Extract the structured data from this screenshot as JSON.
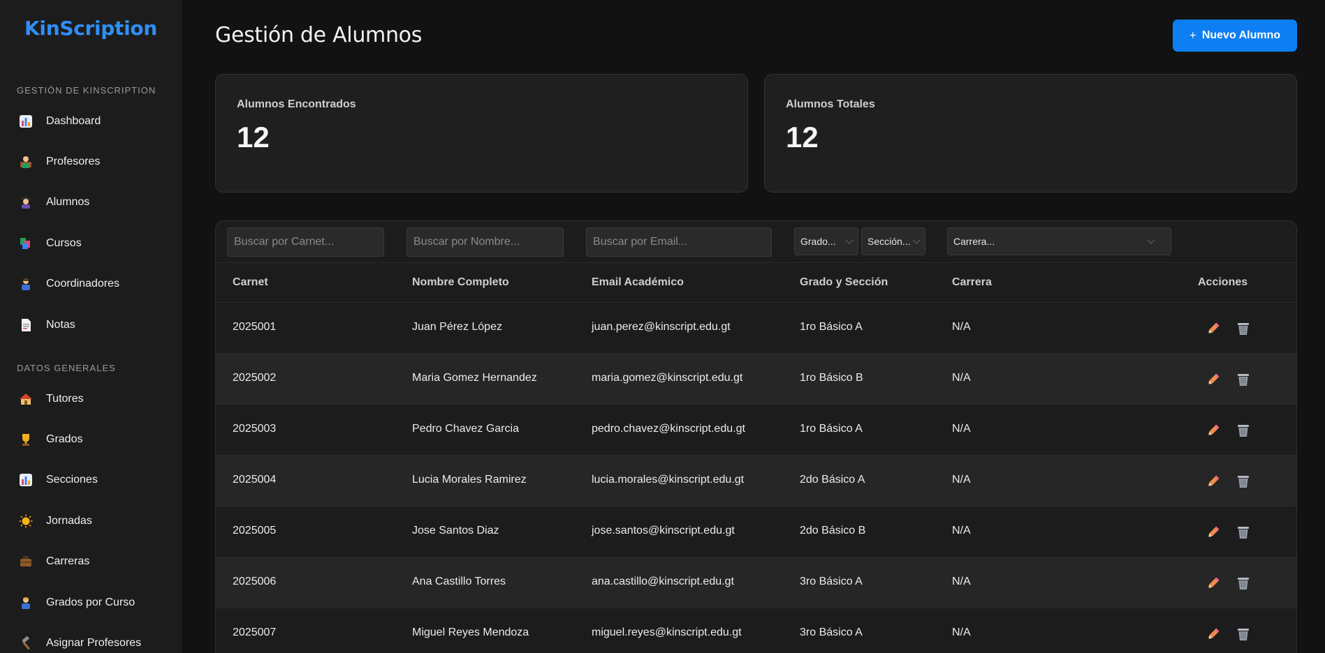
{
  "brand": "KinScription",
  "sidebar": {
    "section1": "GESTIÓN DE KINSCRIPTION",
    "section2": "DATOS GENERALES",
    "items1": [
      {
        "label": "Dashboard",
        "icon": "bar-chart-icon"
      },
      {
        "label": "Profesores",
        "icon": "teacher-icon"
      },
      {
        "label": "Alumnos",
        "icon": "student-icon"
      },
      {
        "label": "Cursos",
        "icon": "books-icon"
      },
      {
        "label": "Coordinadores",
        "icon": "coordinator-icon"
      },
      {
        "label": "Notas",
        "icon": "document-icon"
      }
    ],
    "items2": [
      {
        "label": "Tutores",
        "icon": "house-icon"
      },
      {
        "label": "Grados",
        "icon": "trophy-icon"
      },
      {
        "label": "Secciones",
        "icon": "bar-chart-icon"
      },
      {
        "label": "Jornadas",
        "icon": "sun-icon"
      },
      {
        "label": "Carreras",
        "icon": "briefcase-icon"
      },
      {
        "label": "Grados por Curso",
        "icon": "person-icon"
      },
      {
        "label": "Asignar Profesores",
        "icon": "hammer-icon"
      }
    ]
  },
  "header": {
    "title": "Gestión de Alumnos",
    "new_button": "Nuevo Alumno",
    "new_button_icon": "+"
  },
  "stats": {
    "found_label": "Alumnos Encontrados",
    "found_value": "12",
    "total_label": "Alumnos Totales",
    "total_value": "12"
  },
  "filters": {
    "carnet_placeholder": "Buscar por Carnet...",
    "nombre_placeholder": "Buscar por Nombre...",
    "email_placeholder": "Buscar por Email...",
    "grado": "Grado...",
    "seccion": "Sección...",
    "carrera": "Carrera..."
  },
  "table": {
    "headers": [
      "Carnet",
      "Nombre Completo",
      "Email Académico",
      "Grado y Sección",
      "Carrera",
      "Acciones"
    ],
    "rows": [
      {
        "carnet": "2025001",
        "nombre": "Juan Pérez López",
        "email": "juan.perez@kinscript.edu.gt",
        "grado": "1ro Básico A",
        "carrera": "N/A"
      },
      {
        "carnet": "2025002",
        "nombre": "Maria Gomez Hernandez",
        "email": "maria.gomez@kinscript.edu.gt",
        "grado": "1ro Básico B",
        "carrera": "N/A"
      },
      {
        "carnet": "2025003",
        "nombre": "Pedro Chavez Garcia",
        "email": "pedro.chavez@kinscript.edu.gt",
        "grado": "1ro Básico A",
        "carrera": "N/A"
      },
      {
        "carnet": "2025004",
        "nombre": "Lucia Morales Ramirez",
        "email": "lucia.morales@kinscript.edu.gt",
        "grado": "2do Básico A",
        "carrera": "N/A"
      },
      {
        "carnet": "2025005",
        "nombre": "Jose Santos Diaz",
        "email": "jose.santos@kinscript.edu.gt",
        "grado": "2do Básico B",
        "carrera": "N/A"
      },
      {
        "carnet": "2025006",
        "nombre": "Ana Castillo Torres",
        "email": "ana.castillo@kinscript.edu.gt",
        "grado": "3ro Básico A",
        "carrera": "N/A"
      },
      {
        "carnet": "2025007",
        "nombre": "Miguel Reyes Mendoza",
        "email": "miguel.reyes@kinscript.edu.gt",
        "grado": "3ro Básico A",
        "carrera": "N/A"
      }
    ]
  },
  "colors": {
    "accent": "#0d7ff2",
    "brand": "#2f8ff5",
    "background": "#121212",
    "sidebar": "#1c1c1c",
    "edit_icon": "#f08a4b",
    "delete_icon": "#b9bcc4"
  }
}
